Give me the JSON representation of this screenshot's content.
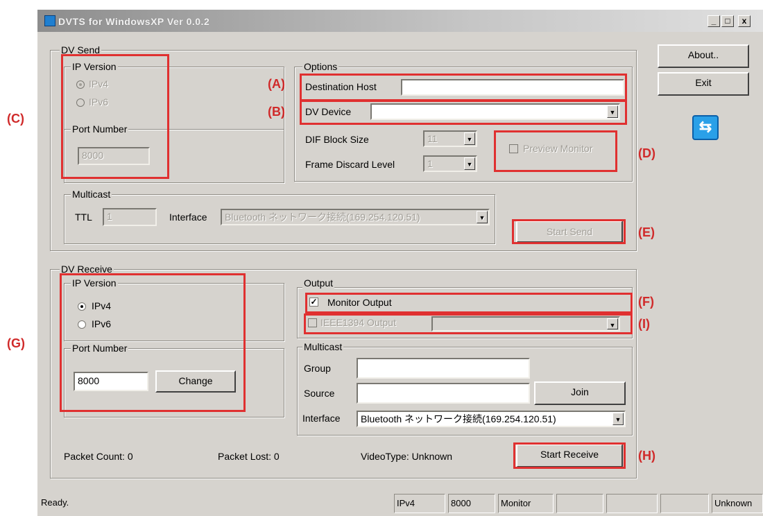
{
  "window": {
    "title": "DVTS for WindowsXP  Ver 0.0.2",
    "min_label": "_",
    "max_label": "□",
    "close_label": "x"
  },
  "side_buttons": {
    "about": "About..",
    "exit": "Exit"
  },
  "dv_send": {
    "group_label": "DV Send",
    "ip_version": {
      "label": "IP Version",
      "ipv4": "IPv4",
      "ipv6": "IPv6",
      "selected": "IPv4"
    },
    "port": {
      "label": "Port Number",
      "value": "8000"
    },
    "options": {
      "label": "Options",
      "destination_host_label": "Destination Host",
      "destination_host_value": "",
      "dv_device_label": "DV Device",
      "dv_device_value": "",
      "dif_block_size_label": "DIF Block Size",
      "dif_block_size_value": "11",
      "frame_discard_label": "Frame Discard Level",
      "frame_discard_value": "1",
      "preview_monitor_label": "Preview Monitor"
    },
    "multicast": {
      "label": "Multicast",
      "ttl_label": "TTL",
      "ttl_value": "1",
      "interface_label": "Interface",
      "interface_value": "Bluetooth ネットワーク接続(169.254.120.51)"
    },
    "start_send_label": "Start Send"
  },
  "dv_receive": {
    "group_label": "DV Receive",
    "ip_version": {
      "label": "IP Version",
      "ipv4": "IPv4",
      "ipv6": "IPv6",
      "selected": "IPv4"
    },
    "port": {
      "label": "Port Number",
      "value": "8000",
      "change_label": "Change"
    },
    "output": {
      "label": "Output",
      "monitor_output_label": "Monitor Output",
      "monitor_output_checked": true,
      "ieee_output_label": "IEEE1394 Output"
    },
    "multicast": {
      "label": "Multicast",
      "group_label": "Group",
      "group_value": "",
      "source_label": "Source",
      "source_value": "",
      "join_label": "Join",
      "interface_label": "Interface",
      "interface_value": "Bluetooth ネットワーク接続(169.254.120.51)"
    },
    "packet_count": "Packet Count: 0",
    "packet_lost": "Packet Lost: 0",
    "video_type": "VideoType:  Unknown",
    "start_receive_label": "Start Receive"
  },
  "annotations": {
    "A": "(A)",
    "B": "(B)",
    "C": "(C)",
    "D": "(D)",
    "E": "(E)",
    "F": "(F)",
    "G": "(G)",
    "H": "(H)",
    "I": "(I)"
  },
  "annotation_color": "#e03030",
  "status_bar": {
    "message": "Ready.",
    "ip": "IPv4",
    "port": "8000",
    "mode": "Monitor",
    "video_type": "Unknown"
  }
}
